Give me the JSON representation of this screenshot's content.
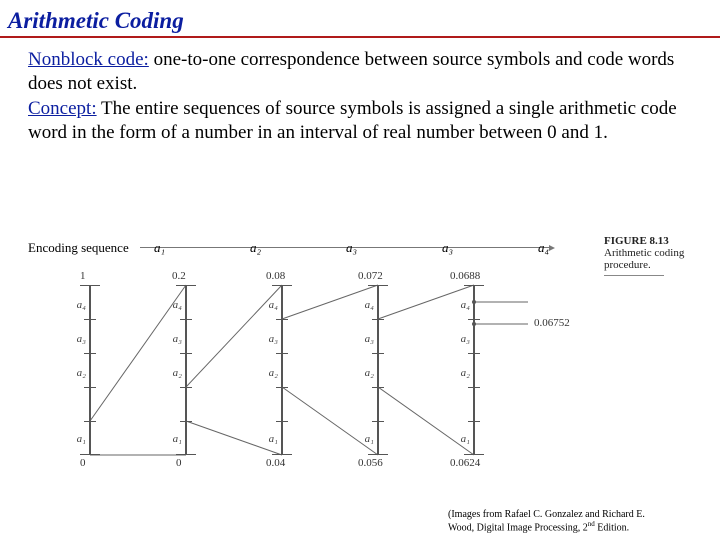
{
  "title": "Arithmetic Coding",
  "body": {
    "key1": "Nonblock code:",
    "txt1": " one-to-one correspondence between source symbols and code words does not exist.",
    "key2": "Concept:",
    "txt2": " The entire sequences of source symbols is assigned a single arithmetic code word in the form of a number in an interval of real number between 0 and 1."
  },
  "encseq": {
    "label": "Encoding sequence",
    "syms": [
      "a₁",
      "a₂",
      "a₃",
      "a₃",
      "a₄"
    ]
  },
  "panels": [
    {
      "top": "1",
      "bottom": "0",
      "tvals": [
        "a₄",
        "a₃",
        "a₂",
        "a₁"
      ]
    },
    {
      "top": "0.2",
      "bottom": "0",
      "tvals": [
        "a₄",
        "a₃",
        "a₂",
        "a₁"
      ]
    },
    {
      "top": "0.08",
      "bottom": "0.04",
      "tvals": [
        "a₄",
        "a₃",
        "a₂",
        "a₁"
      ]
    },
    {
      "top": "0.072",
      "bottom": "0.056",
      "tvals": [
        "a₄",
        "a₃",
        "a₂",
        "a₁"
      ]
    },
    {
      "top": "0.0688",
      "bottom": "0.0624",
      "tvals": [
        "a₄",
        "a₃",
        "a₂",
        "a₁"
      ],
      "extra": "0.06752"
    }
  ],
  "figure": {
    "num": "FIGURE 8.13",
    "cap": "Arithmetic coding procedure."
  },
  "credit": {
    "l1": "(Images from Rafael C. Gonzalez and Richard E.",
    "l2": "Wood, Digital Image Processing, 2",
    "l3": " Edition.",
    "sup": "nd"
  },
  "chart_data": {
    "type": "diagram",
    "encoding_sequence": [
      "a1",
      "a2",
      "a3",
      "a3",
      "a4"
    ],
    "intervals": [
      {
        "low": 0,
        "high": 1
      },
      {
        "low": 0,
        "high": 0.2
      },
      {
        "low": 0.04,
        "high": 0.08
      },
      {
        "low": 0.056,
        "high": 0.072
      },
      {
        "low": 0.0624,
        "high": 0.0688
      }
    ],
    "final_value": 0.06752,
    "symbol_labels": [
      "a1",
      "a2",
      "a3",
      "a4"
    ]
  }
}
